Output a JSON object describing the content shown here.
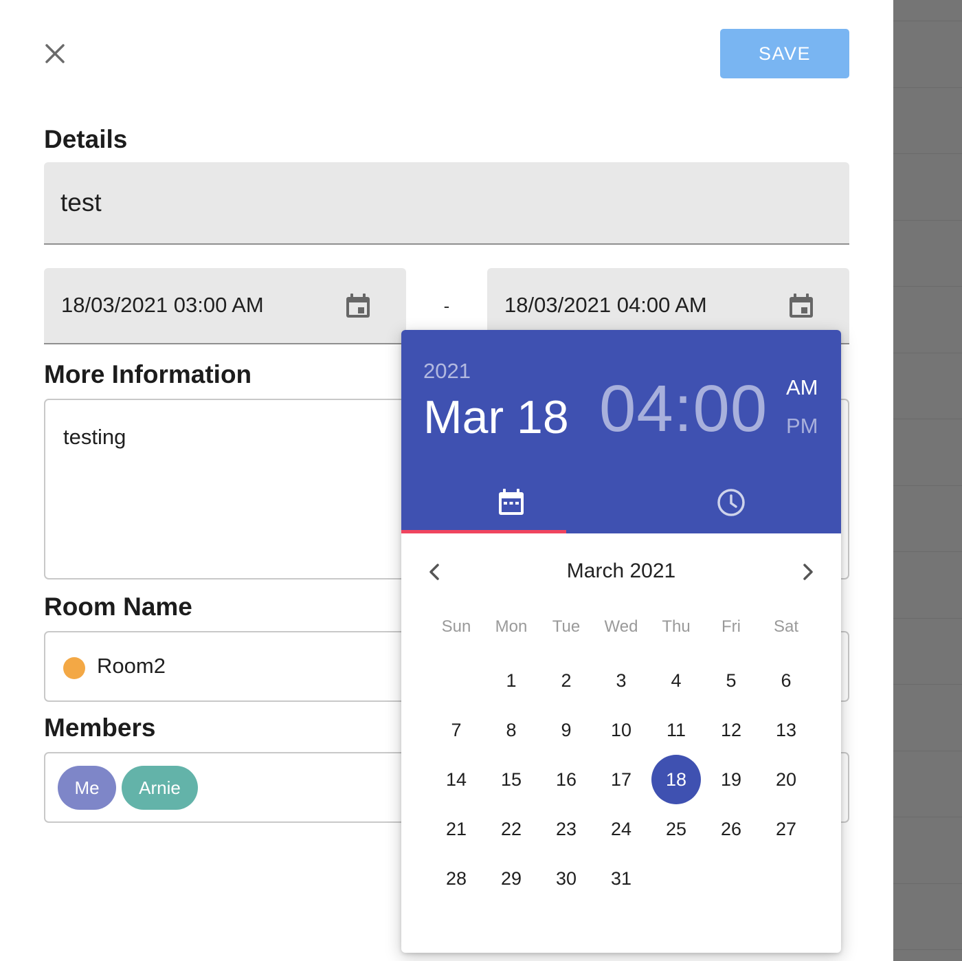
{
  "toolbar": {
    "save_label": "SAVE"
  },
  "details": {
    "title": "Details",
    "value": "test"
  },
  "dates": {
    "start": "18/03/2021 03:00 AM",
    "separator": "-",
    "end": "18/03/2021 04:00 AM"
  },
  "more_info": {
    "title": "More Information",
    "value": "testing"
  },
  "room": {
    "title": "Room Name",
    "value": "Room2",
    "color": "#f3a845"
  },
  "members": {
    "title": "Members",
    "chips": [
      {
        "label": "Me",
        "color": "#7e86c8"
      },
      {
        "label": "Arnie",
        "color": "#63b3a9"
      }
    ]
  },
  "picker": {
    "year": "2021",
    "date": "Mar 18",
    "time": "04:00",
    "am": "AM",
    "pm": "PM",
    "selected_meridiem": "AM",
    "active_tab": "date",
    "month_label": "March 2021",
    "weekdays": [
      "Sun",
      "Mon",
      "Tue",
      "Wed",
      "Thu",
      "Fri",
      "Sat"
    ],
    "first_weekday_index": 1,
    "days_in_month": 31,
    "selected_day": 18,
    "accent": "#3f51b1",
    "tab_indicator_color": "#f0445f"
  }
}
